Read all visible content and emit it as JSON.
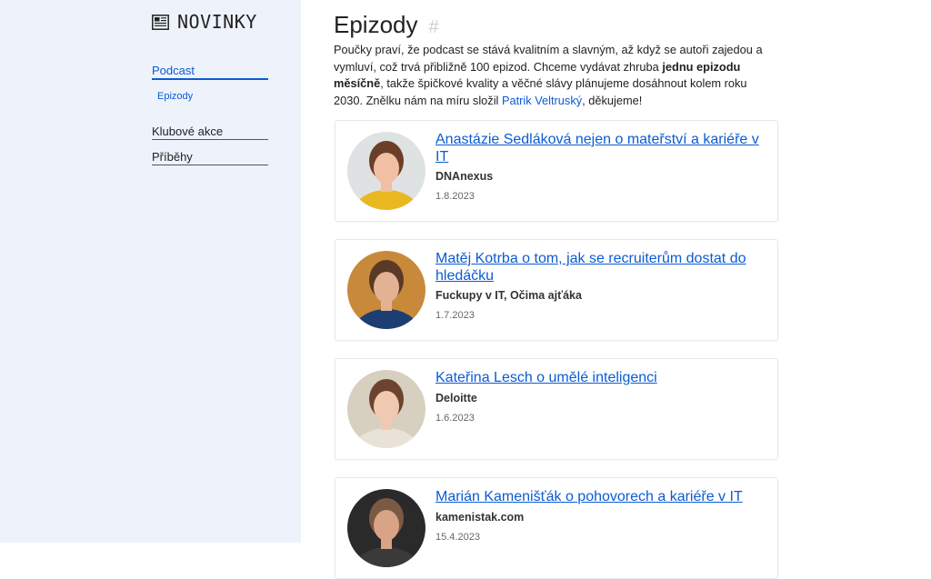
{
  "brand": {
    "name": "NOVINKY",
    "icon": "newspaper-icon"
  },
  "sidebar": {
    "items": [
      {
        "label": "Podcast",
        "active": true
      },
      {
        "label": "Epizody",
        "sub": true
      },
      {
        "label": "Klubové akce"
      },
      {
        "label": "Příběhy"
      }
    ]
  },
  "main": {
    "title": "Epizody",
    "anchor": "#",
    "intro": {
      "part1": "Poučky praví, že podcast se stává kvalitním a slavným, až když se autoři zajedou a vymluví, což trvá přibližně 100 epizod. Chceme vydávat zhruba ",
      "bold": "jednu epizodu měsíčně",
      "part2": ", takže špičkové kvality a věčné slávy plánujeme dosáhnout kolem roku 2030. Znělku nám na míru složil ",
      "link": "Patrik Veltruský",
      "part3": ", děkujeme!"
    },
    "episodes": [
      {
        "title": "Anastázie Sedláková nejen o mateřství a kariéře v IT",
        "company": "DNAnexus",
        "date": "1.8.2023",
        "colors": {
          "bg": "#dfe2e2",
          "skin": "#f0bfa4",
          "hair": "#6b3e28",
          "shirt": "#e9b820"
        }
      },
      {
        "title": "Matěj Kotrba o tom, jak se recruiterům dostat do hledáčku",
        "company": "Fuckupy v IT, Očima ajťáka",
        "date": "1.7.2023",
        "colors": {
          "bg": "#c9893b",
          "skin": "#e3b194",
          "hair": "#5a3a24",
          "shirt": "#1d3e73"
        }
      },
      {
        "title": "Kateřina Lesch o umělé inteligenci",
        "company": "Deloitte",
        "date": "1.6.2023",
        "colors": {
          "bg": "#d7cfbf",
          "skin": "#f1c8b0",
          "hair": "#6d4330",
          "shirt": "#e8e2d8"
        }
      },
      {
        "title": "Marián Kamenišťák o pohovorech a kariéře v IT",
        "company": "kamenistak.com",
        "date": "15.4.2023",
        "colors": {
          "bg": "#2a2a2a",
          "skin": "#d9a385",
          "hair": "#7b5a44",
          "shirt": "#3a3a3a"
        }
      }
    ]
  }
}
